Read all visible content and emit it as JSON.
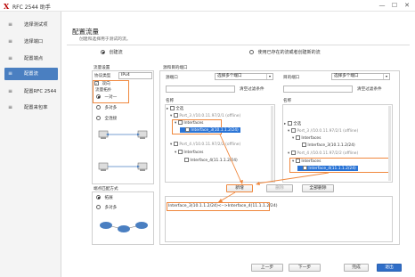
{
  "app": {
    "logo": "X",
    "title": "RFC 2544 助手"
  },
  "window_controls": {
    "min": "—",
    "max": "☐",
    "close": "✕"
  },
  "sidebar": {
    "items": [
      {
        "label": "选择测试项",
        "icon": "list-icon",
        "glyph": "≡",
        "active": false
      },
      {
        "label": "选择端口",
        "icon": "list-icon",
        "glyph": "≡",
        "active": false
      },
      {
        "label": "配置端点",
        "icon": "list-icon",
        "glyph": "≡",
        "active": false
      },
      {
        "label": "配置流",
        "icon": "list-icon",
        "glyph": "≡",
        "active": true
      },
      {
        "label": "配置RFC 2544",
        "icon": "list-icon",
        "glyph": "≡",
        "active": false
      },
      {
        "label": "配置来包率",
        "icon": "list-icon",
        "glyph": "≡",
        "active": false
      }
    ]
  },
  "header": {
    "title": "配置流量",
    "subtitle": "创建和选择用于测试的流。"
  },
  "mode": {
    "create": "创建流",
    "existing": "使用已存在的流或者创建新的流"
  },
  "flow_settings": {
    "title": "流量设置",
    "protocol_label": "协议类型",
    "protocol_value": "IPv4",
    "bidirectional_label": "双向",
    "bidirectional_check": "✓",
    "grouping_title": "流量拓扑",
    "opt_one_to_one": "一对一",
    "opt_many_to_many": "多对多",
    "opt_full_mesh": "全连接"
  },
  "endpoint_mode": {
    "title": "端点匹配方式",
    "opt_extend": "拓展",
    "opt_multi": "多对多"
  },
  "port_panel": {
    "title": "源和目的端口",
    "source_label": "源端口",
    "dest_label": "目的端口",
    "select_multi": "选择多个端口",
    "clear_filter": "清空过滤条件",
    "column_name": "名称",
    "select_all": "全选",
    "source_tree": [
      {
        "level": 0,
        "toggle": "▸",
        "label": "全选"
      },
      {
        "level": 1,
        "toggle": "▾",
        "label": "Port_3 //10.0.11.97/2/1 (offline)"
      },
      {
        "level": 2,
        "toggle": "▾",
        "label": "Interfaces"
      },
      {
        "level": 3,
        "toggle": "",
        "label": "Interface_3(10.1.1.2/24)",
        "selected": true
      },
      {
        "level": 1,
        "toggle": "▾",
        "label": "Port_4 //10.0.11.97/2/2 (offline)"
      },
      {
        "level": 2,
        "toggle": "▾",
        "label": "Interfaces"
      },
      {
        "level": 3,
        "toggle": "",
        "label": "Interface_4(11.1.1.2/24)"
      }
    ],
    "dest_tree": [
      {
        "level": 0,
        "toggle": "▸",
        "label": "全选"
      },
      {
        "level": 1,
        "toggle": "▾",
        "label": "Port_3 //10.0.11.97/2/1 (offline)"
      },
      {
        "level": 2,
        "toggle": "▾",
        "label": "Interfaces"
      },
      {
        "level": 3,
        "toggle": "",
        "label": "Interface_3(10.1.1.2/24)"
      },
      {
        "level": 1,
        "toggle": "▾",
        "label": "Port_4 //10.0.11.97/2/2 (offline)"
      },
      {
        "level": 2,
        "toggle": "▾",
        "label": "Interfaces"
      },
      {
        "level": 3,
        "toggle": "",
        "label": "Interface_4(11.1.1.2/24)",
        "selected": true
      }
    ],
    "add_button": "新增",
    "delete_button": "删除",
    "delete_all_button": "全部删除",
    "result_text": "Interface_3(10.1.1.2/24)<-->Interface_4(11.1.1.2/24)"
  },
  "footer": {
    "prev": "上一步",
    "next": "下一步",
    "finish": "完成",
    "exit": "退出"
  },
  "colors": {
    "accent": "#4a7fc1",
    "highlight": "#f0883e",
    "selected_row": "#2a74d6"
  }
}
